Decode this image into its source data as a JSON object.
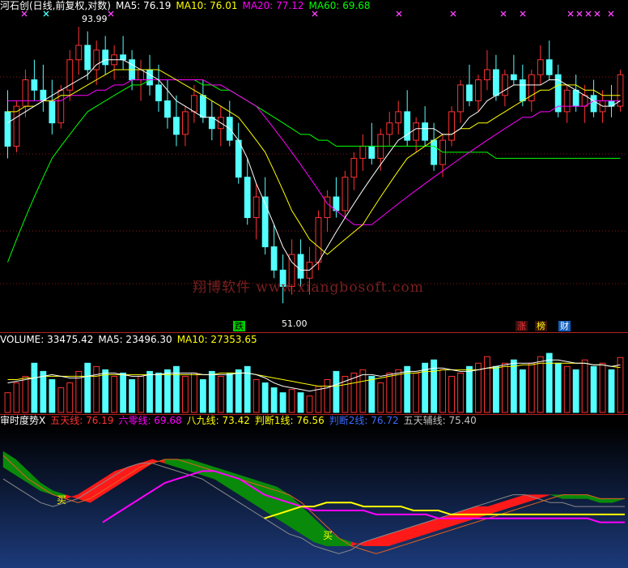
{
  "price_header": {
    "title": "河石创(日线,前复权,对数)",
    "ma5": "MA5: 76.19",
    "ma10": "MA10: 76.01",
    "ma20": "MA20: 77.12",
    "ma60": "MA60: 69.68",
    "colors": {
      "title": "#ffffff",
      "ma5": "#ffffff",
      "ma10": "#ffff00",
      "ma20": "#ff00ff",
      "ma60": "#00ff00"
    }
  },
  "volume_header": {
    "volume": "VOLUME: 33475.42",
    "ma5": "MA5: 23496.30",
    "ma10": "MA10: 27353.65"
  },
  "indicator_header": {
    "name": "审时度势X",
    "five_day": "五天线: 76.19",
    "six_zero": "六零线: 69.68",
    "eight_nine": "八九线: 73.42",
    "judge1": "判断1线: 76.56",
    "judge2": "判断2线: 76.72",
    "five_aux": "五天辅线: 75.40"
  },
  "annotations": {
    "high": "93.99",
    "low": "51.00",
    "die": "跌",
    "zhang": "涨",
    "bang": "榜",
    "cai": "财",
    "buy1": "买",
    "buy2": "买"
  },
  "watermark": "翔博软件 www.xiangbosoft.com",
  "colors": {
    "up": "#ff3232",
    "down": "#54ffff",
    "ma5": "#ffffff",
    "ma10": "#ffff00",
    "ma20": "#ff00ff",
    "ma60": "#00ff00",
    "grid": "#8b1a1a",
    "indicator_bg_top": "#000000",
    "indicator_bg_bottom": "#1c3a7a"
  },
  "chart_data": [
    {
      "type": "candlestick",
      "title": "河石创(日线,前复权,对数)",
      "ylim": [
        49,
        97
      ],
      "ohlc": [
        [
          78,
          82,
          70,
          72
        ],
        [
          72,
          80,
          71,
          79
        ],
        [
          79,
          86,
          77,
          84
        ],
        [
          84,
          88,
          80,
          82
        ],
        [
          82,
          87,
          78,
          80
        ],
        [
          80,
          84,
          74,
          76
        ],
        [
          76,
          83,
          75,
          82
        ],
        [
          82,
          90,
          80,
          88
        ],
        [
          88,
          95,
          85,
          91
        ],
        [
          91,
          94,
          84,
          86
        ],
        [
          86,
          92,
          83,
          90
        ],
        [
          90,
          93,
          85,
          87
        ],
        [
          87,
          91,
          84,
          89
        ],
        [
          89,
          93,
          86,
          88
        ],
        [
          88,
          90,
          82,
          84
        ],
        [
          84,
          88,
          80,
          86
        ],
        [
          86,
          89,
          81,
          83
        ],
        [
          83,
          87,
          78,
          80
        ],
        [
          80,
          84,
          75,
          77
        ],
        [
          77,
          81,
          72,
          74
        ],
        [
          74,
          79,
          72,
          78
        ],
        [
          78,
          83,
          76,
          81
        ],
        [
          81,
          84,
          76,
          77
        ],
        [
          77,
          80,
          73,
          75
        ],
        [
          75,
          79,
          72,
          77
        ],
        [
          77,
          80,
          72,
          73
        ],
        [
          73,
          76,
          66,
          67
        ],
        [
          67,
          70,
          60,
          61
        ],
        [
          61,
          66,
          58,
          64
        ],
        [
          64,
          67,
          56,
          57
        ],
        [
          57,
          60,
          53,
          54
        ],
        [
          54,
          56,
          50,
          52
        ],
        [
          52,
          58,
          51,
          56
        ],
        [
          56,
          58,
          52,
          53
        ],
        [
          53,
          57,
          51,
          55
        ],
        [
          55,
          62,
          54,
          61
        ],
        [
          61,
          65,
          59,
          64
        ],
        [
          64,
          67,
          61,
          62
        ],
        [
          62,
          68,
          61,
          67
        ],
        [
          67,
          71,
          65,
          70
        ],
        [
          70,
          74,
          68,
          72
        ],
        [
          72,
          76,
          69,
          70
        ],
        [
          70,
          75,
          68,
          74
        ],
        [
          74,
          78,
          72,
          76
        ],
        [
          76,
          80,
          74,
          78
        ],
        [
          78,
          82,
          72,
          73
        ],
        [
          73,
          77,
          71,
          76
        ],
        [
          76,
          79,
          72,
          73
        ],
        [
          73,
          76,
          68,
          69
        ],
        [
          69,
          74,
          67,
          73
        ],
        [
          73,
          79,
          72,
          78
        ],
        [
          78,
          84,
          76,
          83
        ],
        [
          83,
          87,
          79,
          80
        ],
        [
          80,
          85,
          78,
          84
        ],
        [
          84,
          90,
          82,
          86
        ],
        [
          86,
          89,
          80,
          81
        ],
        [
          81,
          86,
          79,
          85
        ],
        [
          85,
          89,
          83,
          84
        ],
        [
          84,
          87,
          79,
          80
        ],
        [
          80,
          86,
          78,
          85
        ],
        [
          85,
          91,
          83,
          88
        ],
        [
          88,
          92,
          84,
          85
        ],
        [
          85,
          87,
          77,
          78
        ],
        [
          78,
          83,
          76,
          82
        ],
        [
          82,
          85,
          78,
          79
        ],
        [
          79,
          83,
          76,
          81
        ],
        [
          81,
          84,
          77,
          78
        ],
        [
          78,
          82,
          76,
          80
        ],
        [
          80,
          83,
          77,
          79
        ],
        [
          79,
          86,
          78,
          85
        ]
      ],
      "ma5": [
        76,
        77,
        78,
        79,
        80,
        81,
        82,
        83,
        84,
        85,
        87,
        88,
        88,
        88,
        87,
        86,
        85,
        84,
        82,
        80,
        79,
        78,
        77,
        77,
        76,
        75,
        73,
        70,
        66,
        63,
        60,
        57,
        55,
        54,
        54,
        55,
        57,
        59,
        61,
        63,
        65,
        67,
        69,
        71,
        73,
        74,
        75,
        75,
        75,
        74,
        74,
        75,
        77,
        78,
        80,
        81,
        82,
        83,
        83,
        83,
        83,
        84,
        84,
        83,
        82,
        81,
        80,
        79,
        79,
        80
      ],
      "ma10": [
        78,
        78,
        79,
        79,
        80,
        80,
        81,
        81,
        82,
        83,
        84,
        85,
        86,
        86,
        86,
        86,
        86,
        86,
        85,
        84,
        83,
        82,
        81,
        80,
        79,
        78,
        77,
        75,
        73,
        71,
        68,
        65,
        62,
        60,
        58,
        57,
        56,
        57,
        58,
        59,
        60,
        62,
        64,
        66,
        68,
        70,
        71,
        72,
        73,
        74,
        74,
        75,
        75,
        76,
        76,
        77,
        78,
        79,
        80,
        81,
        82,
        82,
        83,
        83,
        83,
        82,
        82,
        81,
        81,
        81
      ],
      "ma20": [
        80,
        80,
        80,
        80,
        80,
        80,
        80,
        81,
        81,
        81,
        82,
        82,
        83,
        83,
        84,
        84,
        84,
        84,
        84,
        84,
        84,
        84,
        84,
        83,
        83,
        82,
        81,
        80,
        79,
        77,
        75,
        73,
        71,
        69,
        67,
        65,
        63,
        62,
        61,
        60,
        60,
        60,
        61,
        62,
        63,
        64,
        65,
        66,
        67,
        68,
        69,
        70,
        71,
        72,
        73,
        74,
        75,
        76,
        77,
        77,
        78,
        78,
        79,
        79,
        79,
        79,
        80,
        80,
        80,
        80
      ],
      "ma60": [
        55,
        58,
        61,
        64,
        67,
        70,
        72,
        74,
        76,
        78,
        79,
        80,
        81,
        82,
        83,
        83,
        84,
        84,
        84,
        84,
        84,
        84,
        83,
        83,
        82,
        82,
        81,
        80,
        79,
        78,
        77,
        76,
        75,
        74,
        74,
        73,
        73,
        72,
        72,
        72,
        72,
        72,
        72,
        72,
        72,
        72,
        72,
        72,
        72,
        71,
        71,
        71,
        71,
        71,
        71,
        70,
        70,
        70,
        70,
        70,
        70,
        70,
        70,
        70,
        70,
        70,
        70,
        70,
        70,
        70
      ]
    },
    {
      "type": "bar",
      "title": "VOLUME",
      "ylim": [
        0,
        40000
      ],
      "values": [
        12000,
        18000,
        22000,
        30000,
        25000,
        20000,
        15000,
        18000,
        25000,
        30000,
        28000,
        26000,
        22000,
        24000,
        20000,
        22000,
        25000,
        24000,
        26000,
        28000,
        22000,
        24000,
        20000,
        25000,
        22000,
        24000,
        26000,
        28000,
        20000,
        18000,
        15000,
        12000,
        14000,
        12000,
        10000,
        16000,
        20000,
        25000,
        22000,
        24000,
        26000,
        22000,
        18000,
        24000,
        26000,
        28000,
        24000,
        30000,
        32000,
        26000,
        22000,
        24000,
        28000,
        30000,
        34000,
        28000,
        30000,
        32000,
        26000,
        30000,
        34000,
        36000,
        30000,
        28000,
        26000,
        32000,
        28000,
        30000,
        26000,
        33475
      ],
      "up": [
        true,
        true,
        true,
        false,
        false,
        false,
        true,
        true,
        true,
        false,
        true,
        false,
        true,
        false,
        false,
        true,
        false,
        false,
        false,
        false,
        true,
        true,
        false,
        false,
        true,
        false,
        false,
        false,
        true,
        false,
        false,
        false,
        true,
        false,
        true,
        true,
        true,
        false,
        true,
        true,
        true,
        false,
        true,
        true,
        true,
        false,
        true,
        false,
        false,
        true,
        true,
        true,
        false,
        true,
        true,
        false,
        true,
        false,
        false,
        true,
        true,
        false,
        false,
        true,
        false,
        true,
        false,
        true,
        false,
        true
      ],
      "ma5": [
        18000,
        19000,
        20000,
        21000,
        22000,
        23000,
        22000,
        21000,
        21000,
        22000,
        23000,
        24000,
        24000,
        23000,
        22000,
        22000,
        23000,
        23000,
        24000,
        24000,
        24000,
        24000,
        23000,
        23000,
        23000,
        23000,
        24000,
        24000,
        23000,
        21000,
        18000,
        16000,
        15000,
        14000,
        13000,
        14000,
        15000,
        17000,
        19000,
        21000,
        23000,
        23000,
        22000,
        23000,
        24000,
        25000,
        25000,
        26000,
        27000,
        27000,
        26000,
        25000,
        25000,
        26000,
        27000,
        28000,
        29000,
        30000,
        30000,
        30000,
        31000,
        32000,
        32000,
        31000,
        30000,
        30000,
        29000,
        29000,
        28000,
        29000
      ],
      "ma10": [
        20000,
        20000,
        21000,
        21000,
        22000,
        22000,
        22000,
        22000,
        22000,
        22000,
        22000,
        23000,
        23000,
        23000,
        23000,
        23000,
        23000,
        23000,
        23000,
        23000,
        23000,
        23000,
        23000,
        23000,
        24000,
        24000,
        24000,
        24000,
        23000,
        22000,
        21000,
        20000,
        19000,
        18000,
        17000,
        16000,
        16000,
        16000,
        17000,
        18000,
        19000,
        20000,
        21000,
        22000,
        23000,
        24000,
        24000,
        25000,
        25000,
        26000,
        26000,
        26000,
        26000,
        26000,
        27000,
        27000,
        28000,
        28000,
        29000,
        29000,
        30000,
        30000,
        30000,
        30000,
        30000,
        30000,
        29000,
        29000,
        28000,
        27354
      ]
    },
    {
      "type": "line",
      "title": "审时度势X",
      "ylim": [
        60,
        95
      ],
      "series": [
        {
          "name": "五天线",
          "values": [
            88,
            85,
            82,
            80,
            78,
            77,
            76,
            77,
            79,
            81,
            83,
            85,
            86,
            87,
            87,
            86,
            85,
            84,
            83,
            82,
            81,
            80,
            79,
            78,
            76,
            73,
            70,
            67,
            65,
            64,
            63,
            64,
            65,
            66,
            67,
            68,
            69,
            70,
            71,
            72,
            73,
            74,
            75,
            76,
            77,
            78,
            78,
            78,
            77,
            77,
            77
          ]
        },
        {
          "name": "六零线",
          "values": [
            null,
            null,
            null,
            null,
            null,
            null,
            null,
            null,
            71,
            73,
            75,
            77,
            79,
            81,
            82,
            83,
            84,
            84,
            83,
            82,
            80,
            78,
            77,
            76,
            75,
            74,
            74,
            74,
            74,
            74,
            73,
            73,
            73,
            73,
            73,
            72,
            72,
            72,
            72,
            72,
            72,
            72,
            72,
            72,
            72,
            72,
            72,
            72,
            71,
            71,
            71
          ]
        },
        {
          "name": "八九线",
          "values": [
            null,
            null,
            null,
            null,
            null,
            null,
            null,
            null,
            null,
            null,
            null,
            null,
            null,
            null,
            null,
            null,
            null,
            null,
            null,
            null,
            null,
            72,
            73,
            74,
            75,
            75,
            76,
            76,
            76,
            75,
            75,
            75,
            75,
            74,
            74,
            74,
            73,
            73,
            73,
            73,
            73,
            73,
            73,
            73,
            73,
            73,
            73,
            73,
            73,
            73,
            73
          ]
        },
        {
          "name": "判断1线",
          "values": [
            85,
            83,
            81,
            79,
            78,
            77,
            78,
            80,
            82,
            84,
            85,
            86,
            87,
            86,
            85,
            84,
            83,
            82,
            80,
            78,
            76,
            74,
            72,
            70,
            68,
            66,
            65,
            65,
            65,
            66,
            67,
            68,
            69,
            70,
            71,
            72,
            73,
            74,
            75,
            75,
            76,
            77,
            78,
            78,
            78,
            77,
            77,
            77,
            76,
            76,
            77
          ]
        },
        {
          "name": "判断2线",
          "values": [
            89,
            87,
            84,
            81,
            79,
            78,
            77,
            76,
            78,
            80,
            82,
            84,
            86,
            87,
            87,
            87,
            86,
            85,
            84,
            83,
            82,
            81,
            80,
            78,
            75,
            72,
            69,
            67,
            66,
            65,
            65,
            65,
            66,
            67,
            68,
            69,
            70,
            71,
            72,
            73,
            74,
            75,
            76,
            77,
            78,
            78,
            78,
            78,
            77,
            77,
            77
          ]
        },
        {
          "name": "五天辅线",
          "values": [
            82,
            80,
            78,
            76,
            75,
            76,
            77,
            79,
            81,
            83,
            85,
            86,
            86,
            85,
            84,
            83,
            82,
            80,
            78,
            76,
            74,
            72,
            70,
            68,
            67,
            65,
            64,
            63,
            64,
            66,
            67,
            68,
            69,
            70,
            71,
            72,
            73,
            74,
            75,
            76,
            77,
            78,
            78,
            77,
            76,
            76,
            75,
            75,
            75,
            75,
            75
          ]
        }
      ]
    }
  ]
}
